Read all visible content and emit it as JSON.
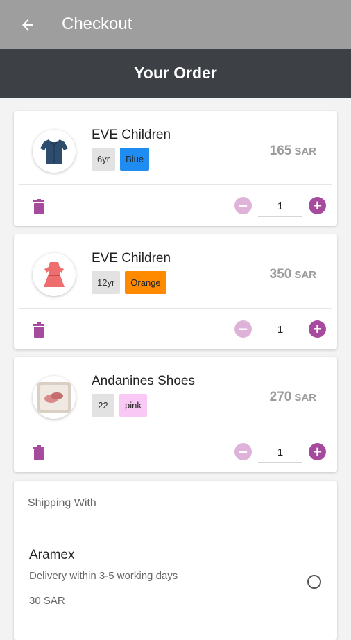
{
  "appbar": {
    "title": "Checkout",
    "back_icon": "arrow-left-icon"
  },
  "header": {
    "title": "Your Order"
  },
  "items": [
    {
      "name": "EVE Children",
      "size": "6yr",
      "color_label": "Blue",
      "color_hex": "#1e8cf0",
      "price": "165",
      "currency": "SAR",
      "qty": "1",
      "image": "shirt-icon"
    },
    {
      "name": "EVE Children",
      "size": "12yr",
      "color_label": "Orange",
      "color_hex": "#ff8a00",
      "price": "350",
      "currency": "SAR",
      "qty": "1",
      "image": "dress-icon"
    },
    {
      "name": "Andanines Shoes",
      "size": "22",
      "color_label": "pink",
      "color_hex": "#f9c8f5",
      "price": "270",
      "currency": "SAR",
      "qty": "1",
      "image": "shoes-icon"
    }
  ],
  "shipping": {
    "label": "Shipping With",
    "carrier": "Aramex",
    "description": "Delivery within 3-5 working days",
    "price": "30 SAR"
  },
  "colors": {
    "accent": "#a54a9c",
    "accent_light": "#dfb3d9",
    "appbar": "#9e9e9e",
    "header": "#3d4045"
  }
}
